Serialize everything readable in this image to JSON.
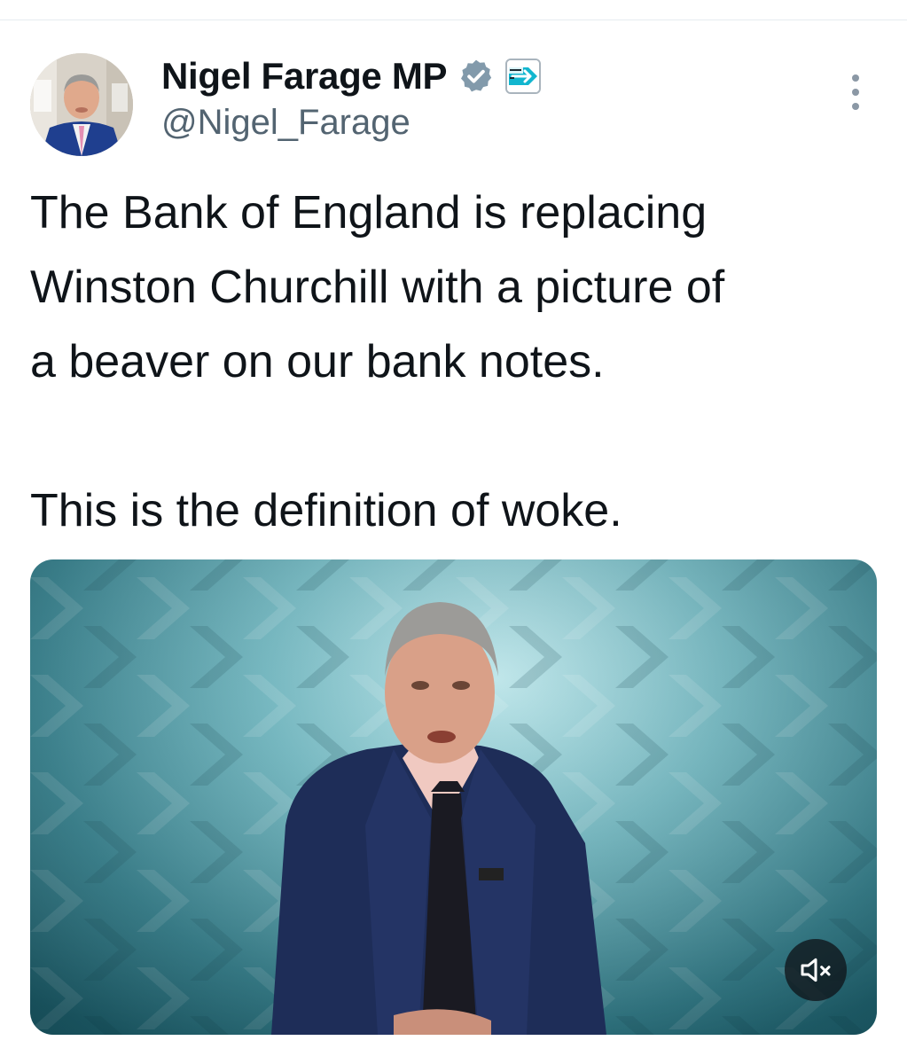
{
  "tweet": {
    "author": {
      "display_name": "Nigel Farage MP",
      "handle": "@Nigel_Farage",
      "verified_icon": "verified-badge-icon",
      "affiliate_badge": "reform-uk-logo"
    },
    "text": {
      "line1": "The Bank of England is replacing",
      "line2": "Winston Churchill with a picture of",
      "line3": "a beaver on our bank notes.",
      "line4": "This is the definition of woke."
    },
    "media": {
      "type": "video",
      "mute_icon": "speaker-muted-icon"
    }
  },
  "colors": {
    "text_primary": "#0f1419",
    "text_secondary": "#536471",
    "verified_badge": "#829aab",
    "media_teal": "#2f7f8c",
    "reform_cyan": "#12b6cf"
  }
}
